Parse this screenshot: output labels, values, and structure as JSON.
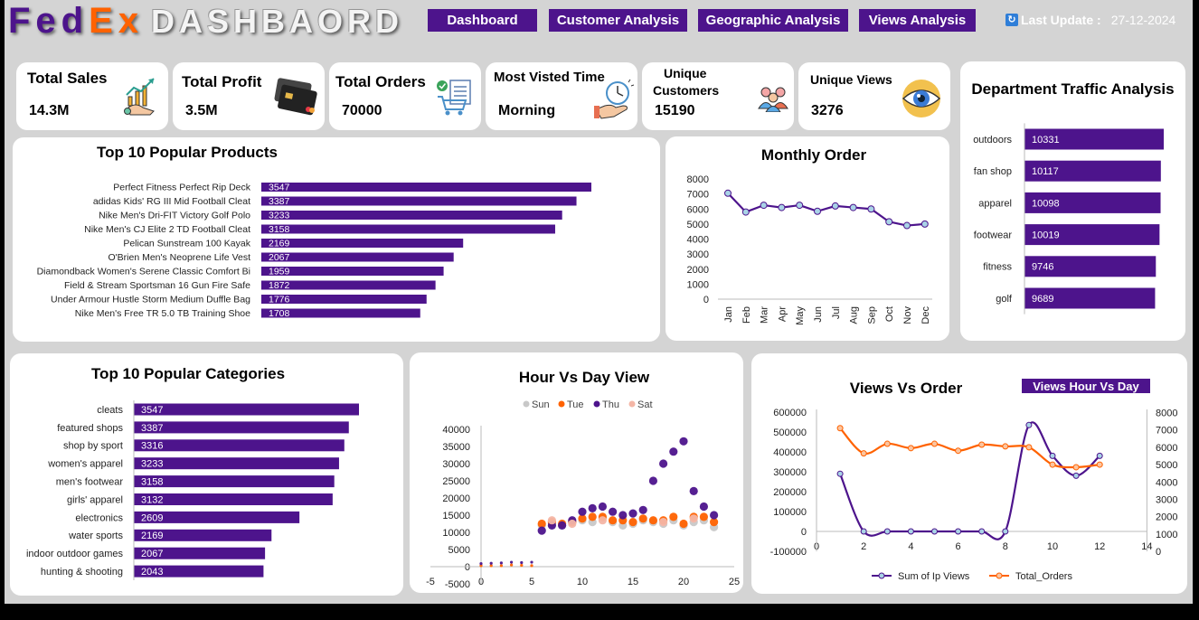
{
  "header": {
    "logo_fed": "Fed",
    "logo_ex": "Ex",
    "title": "DASHBAORD",
    "nav": [
      "Dashboard",
      "Customer Analysis",
      "Geographic Analysis",
      "Views Analysis"
    ],
    "last_update_label": "Last Update :",
    "last_update_value": "27-12-2024"
  },
  "kpis": {
    "total_sales": {
      "label": "Total Sales",
      "value": "14.3M"
    },
    "total_profit": {
      "label": "Total Profit",
      "value": "3.5M"
    },
    "total_orders": {
      "label": "Total Orders",
      "value": "70000"
    },
    "most_visited": {
      "label": "Most Visted Time",
      "value": "Morning"
    },
    "unique_customers": {
      "label_line1": "Unique",
      "label_line2": "Customers",
      "value": "15190"
    },
    "unique_views": {
      "label": "Unique Views",
      "value": "3276"
    }
  },
  "colors": {
    "purple": "#4d148c",
    "orange": "#ff6200",
    "light_blue": "#a9d3e6",
    "gray": "#d4d4d4"
  },
  "icons": [
    "growth-chart-icon",
    "credit-card-icon",
    "shopping-cart-icon",
    "clock-hand-icon",
    "customers-group-icon",
    "eye-icon",
    "refresh-icon"
  ],
  "charts": {
    "top_products": {
      "title": "Top 10 Popular Products",
      "chart_data": {
        "type": "bar",
        "categories": [
          "Perfect Fitness Perfect Rip Deck",
          "adidas Kids' RG III Mid Football Cleat",
          "Nike Men's Dri-FIT Victory Golf Polo",
          "Nike Men's CJ Elite 2 TD Football Cleat",
          "Pelican Sunstream 100 Kayak",
          "O'Brien Men's Neoprene Life Vest",
          "Diamondback Women's Serene Classic Comfort Bi",
          "Field & Stream Sportsman 16 Gun Fire Safe",
          "Under Armour Hustle Storm Medium Duffle Bag",
          "Nike Men's Free TR 5.0 TB Training Shoe"
        ],
        "values": [
          3547,
          3387,
          3233,
          3158,
          2169,
          2067,
          1959,
          1872,
          1776,
          1708
        ],
        "orientation": "horizontal"
      }
    },
    "monthly_order": {
      "title": "Monthly Order",
      "chart_data": {
        "type": "line",
        "categories": [
          "Jan",
          "Feb",
          "Mar",
          "Apr",
          "May",
          "Jun",
          "Jul",
          "Aug",
          "Sep",
          "Oct",
          "Nov",
          "Dec"
        ],
        "values": [
          7050,
          5800,
          6250,
          6100,
          6250,
          5850,
          6200,
          6100,
          6000,
          5150,
          4900,
          5000
        ],
        "ylim": [
          0,
          8000
        ],
        "yticks": [
          "8000",
          "7000",
          "6000",
          "5000",
          "4000",
          "3000",
          "2000",
          "1000",
          "0"
        ]
      }
    },
    "department_traffic": {
      "title": "Department Traffic Analysis",
      "chart_data": {
        "type": "bar",
        "categories": [
          "outdoors",
          "fan shop",
          "apparel",
          "footwear",
          "fitness",
          "golf"
        ],
        "values": [
          10331,
          10117,
          10098,
          10019,
          9746,
          9689
        ],
        "orientation": "horizontal"
      }
    },
    "top_categories": {
      "title": "Top 10 Popular Categories",
      "chart_data": {
        "type": "bar",
        "categories": [
          "cleats",
          "featured shops",
          "shop by sport",
          "women's apparel",
          "men's footwear",
          "girls' apparel",
          "electronics",
          "water sports",
          "indoor outdoor games",
          "hunting & shooting"
        ],
        "values": [
          3547,
          3387,
          3316,
          3233,
          3158,
          3132,
          2609,
          2169,
          2067,
          2043
        ],
        "orientation": "horizontal"
      }
    },
    "hour_vs_day": {
      "title": "Hour Vs Day View",
      "chart_data": {
        "type": "scatter",
        "legend": [
          "Sun",
          "Tue",
          "Thu",
          "Sat"
        ],
        "legend_colors": [
          "#c8c8c8",
          "#ff6200",
          "#4d148c",
          "#f4b6a6"
        ],
        "xlim": [
          -5,
          25
        ],
        "ylim": [
          -5000,
          40000
        ],
        "xticks": [
          "-5",
          "0",
          "5",
          "10",
          "15",
          "20",
          "25"
        ],
        "yticks": [
          "40000",
          "35000",
          "30000",
          "25000",
          "20000",
          "15000",
          "10000",
          "5000",
          "0",
          "-5000"
        ],
        "series": [
          {
            "name": "Sun",
            "points": [
              [
                6,
                12000
              ],
              [
                7,
                12500
              ],
              [
                8,
                12000
              ],
              [
                9,
                13000
              ],
              [
                10,
                13500
              ],
              [
                11,
                13000
              ],
              [
                12,
                14000
              ],
              [
                13,
                13000
              ],
              [
                14,
                12000
              ],
              [
                15,
                12500
              ],
              [
                16,
                13500
              ],
              [
                17,
                13000
              ],
              [
                18,
                12500
              ],
              [
                19,
                13500
              ],
              [
                20,
                12000
              ],
              [
                21,
                13000
              ],
              [
                22,
                13500
              ],
              [
                23,
                11500
              ]
            ]
          },
          {
            "name": "Tue",
            "points": [
              [
                0,
                300
              ],
              [
                1,
                300
              ],
              [
                2,
                300
              ],
              [
                3,
                500
              ],
              [
                4,
                400
              ],
              [
                5,
                300
              ],
              [
                6,
                12500
              ],
              [
                7,
                13000
              ],
              [
                8,
                12500
              ],
              [
                9,
                13000
              ],
              [
                10,
                14000
              ],
              [
                11,
                14500
              ],
              [
                12,
                14500
              ],
              [
                13,
                13500
              ],
              [
                14,
                13500
              ],
              [
                15,
                13000
              ],
              [
                16,
                14000
              ],
              [
                17,
                13500
              ],
              [
                18,
                13500
              ],
              [
                19,
                14500
              ],
              [
                20,
                12500
              ],
              [
                21,
                14500
              ],
              [
                22,
                14500
              ],
              [
                23,
                13000
              ]
            ]
          },
          {
            "name": "Thu",
            "points": [
              [
                0,
                900
              ],
              [
                1,
                1000
              ],
              [
                2,
                1100
              ],
              [
                3,
                1300
              ],
              [
                4,
                1200
              ],
              [
                5,
                1300
              ],
              [
                6,
                10500
              ],
              [
                7,
                12000
              ],
              [
                8,
                12000
              ],
              [
                9,
                13500
              ],
              [
                10,
                16000
              ],
              [
                11,
                17000
              ],
              [
                12,
                17500
              ],
              [
                13,
                16000
              ],
              [
                14,
                15000
              ],
              [
                15,
                15500
              ],
              [
                16,
                16500
              ],
              [
                17,
                25000
              ],
              [
                18,
                30000
              ],
              [
                19,
                33500
              ],
              [
                20,
                36500
              ],
              [
                21,
                22000
              ],
              [
                22,
                17500
              ],
              [
                23,
                15000
              ]
            ]
          },
          {
            "name": "Sat",
            "points": [
              [
                7,
                13500
              ],
              [
                9,
                12500
              ],
              [
                12,
                13500
              ],
              [
                18,
                13000
              ],
              [
                21,
                14000
              ]
            ]
          }
        ]
      }
    },
    "views_vs_order": {
      "title": "Views Vs Order",
      "button": "Views Hour Vs Day",
      "chart_data": {
        "type": "line",
        "xlim": [
          0,
          14
        ],
        "xticks": [
          "0",
          "2",
          "4",
          "6",
          "8",
          "10",
          "12",
          "14"
        ],
        "ylim_left": [
          -100000,
          600000
        ],
        "yticks_left": [
          "600000",
          "500000",
          "400000",
          "300000",
          "200000",
          "100000",
          "0",
          "-100000"
        ],
        "ylim_right": [
          0,
          8000
        ],
        "yticks_right": [
          "8000",
          "7000",
          "6000",
          "5000",
          "4000",
          "3000",
          "2000",
          "1000",
          "0"
        ],
        "series": [
          {
            "name": "Sum of Ip Views",
            "axis": "left",
            "x": [
              1,
              2,
              3,
              4,
              5,
              6,
              7,
              8,
              9,
              10,
              11,
              12
            ],
            "values": [
              290000,
              0,
              0,
              0,
              0,
              0,
              0,
              0,
              535000,
              380000,
              280000,
              380000
            ]
          },
          {
            "name": "Total_Orders",
            "axis": "right",
            "x": [
              1,
              2,
              3,
              4,
              5,
              6,
              7,
              8,
              9,
              10,
              11,
              12
            ],
            "values": [
              7100,
              5650,
              6200,
              5950,
              6200,
              5800,
              6150,
              6050,
              6000,
              5000,
              4850,
              5000
            ]
          }
        ]
      }
    }
  }
}
